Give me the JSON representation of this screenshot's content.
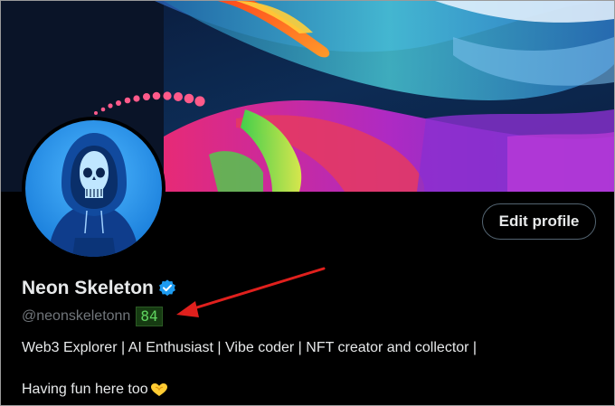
{
  "profile": {
    "display_name": "Neon Skeleton",
    "handle": "@neonskeletonn",
    "score_badge": "84",
    "bio_line1": "Web3 Explorer | AI Enthusiast | Vibe coder | NFT creator and collector |",
    "bio_line2": "Having fun here too",
    "edit_label": "Edit profile"
  },
  "icons": {
    "verified": "verified-badge-icon",
    "heart": "yellow-heart-hands-icon",
    "annotation": "red-arrow-annotation"
  },
  "colors": {
    "background": "#000000",
    "text_primary": "#e7e9ea",
    "text_secondary": "#71767b",
    "verified_blue": "#1d9bf0",
    "badge_bg": "#163b12",
    "badge_text": "#5fd35f",
    "annotation_red": "#e0201d"
  }
}
